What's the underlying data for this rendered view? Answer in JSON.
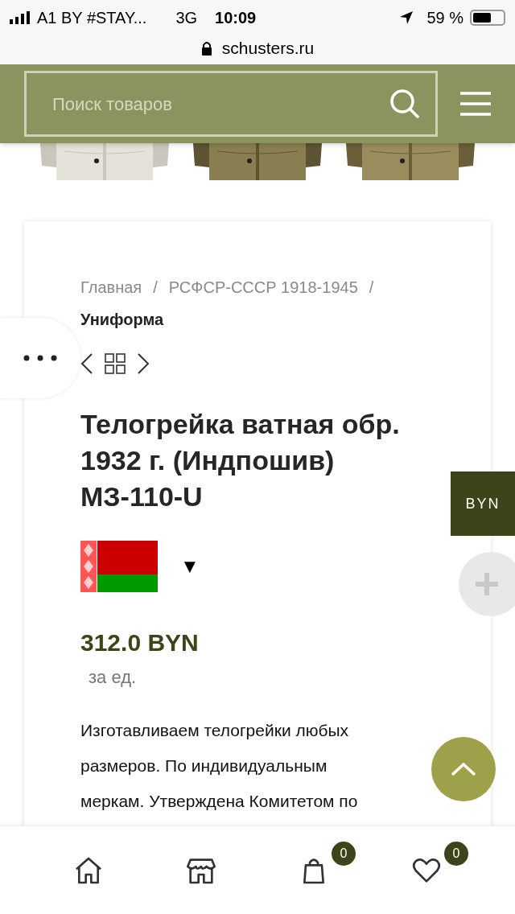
{
  "status_bar": {
    "carrier": "A1 BY #STAY...",
    "network": "3G",
    "time": "10:09",
    "battery": "59 %"
  },
  "browser": {
    "url": "schusters.ru"
  },
  "header": {
    "search": {
      "placeholder": "Поиск товаров"
    }
  },
  "breadcrumbs": [
    {
      "label": "Главная",
      "current": false
    },
    {
      "label": "РСФСР-СССР 1918-1945",
      "current": false
    },
    {
      "label": "Униформа",
      "current": true
    }
  ],
  "breadcrumb_separator": "/",
  "product": {
    "title": "Телогрейка ватная обр. 1932 г. (Индпошив) МЗ-110-U",
    "price": "312.0 BYN",
    "unit": "за ед.",
    "description": "Изготавливаем телогрейки любых размеров. По индивидуальным меркам. Утверждена Комитетом по"
  },
  "currency_selector": {
    "arrow": "▼"
  },
  "currency_tab": "BYN",
  "bottom_nav": [
    {
      "kind": "home"
    },
    {
      "kind": "store"
    },
    {
      "kind": "cart",
      "badge": "0"
    },
    {
      "kind": "favorites",
      "badge": "0"
    }
  ]
}
